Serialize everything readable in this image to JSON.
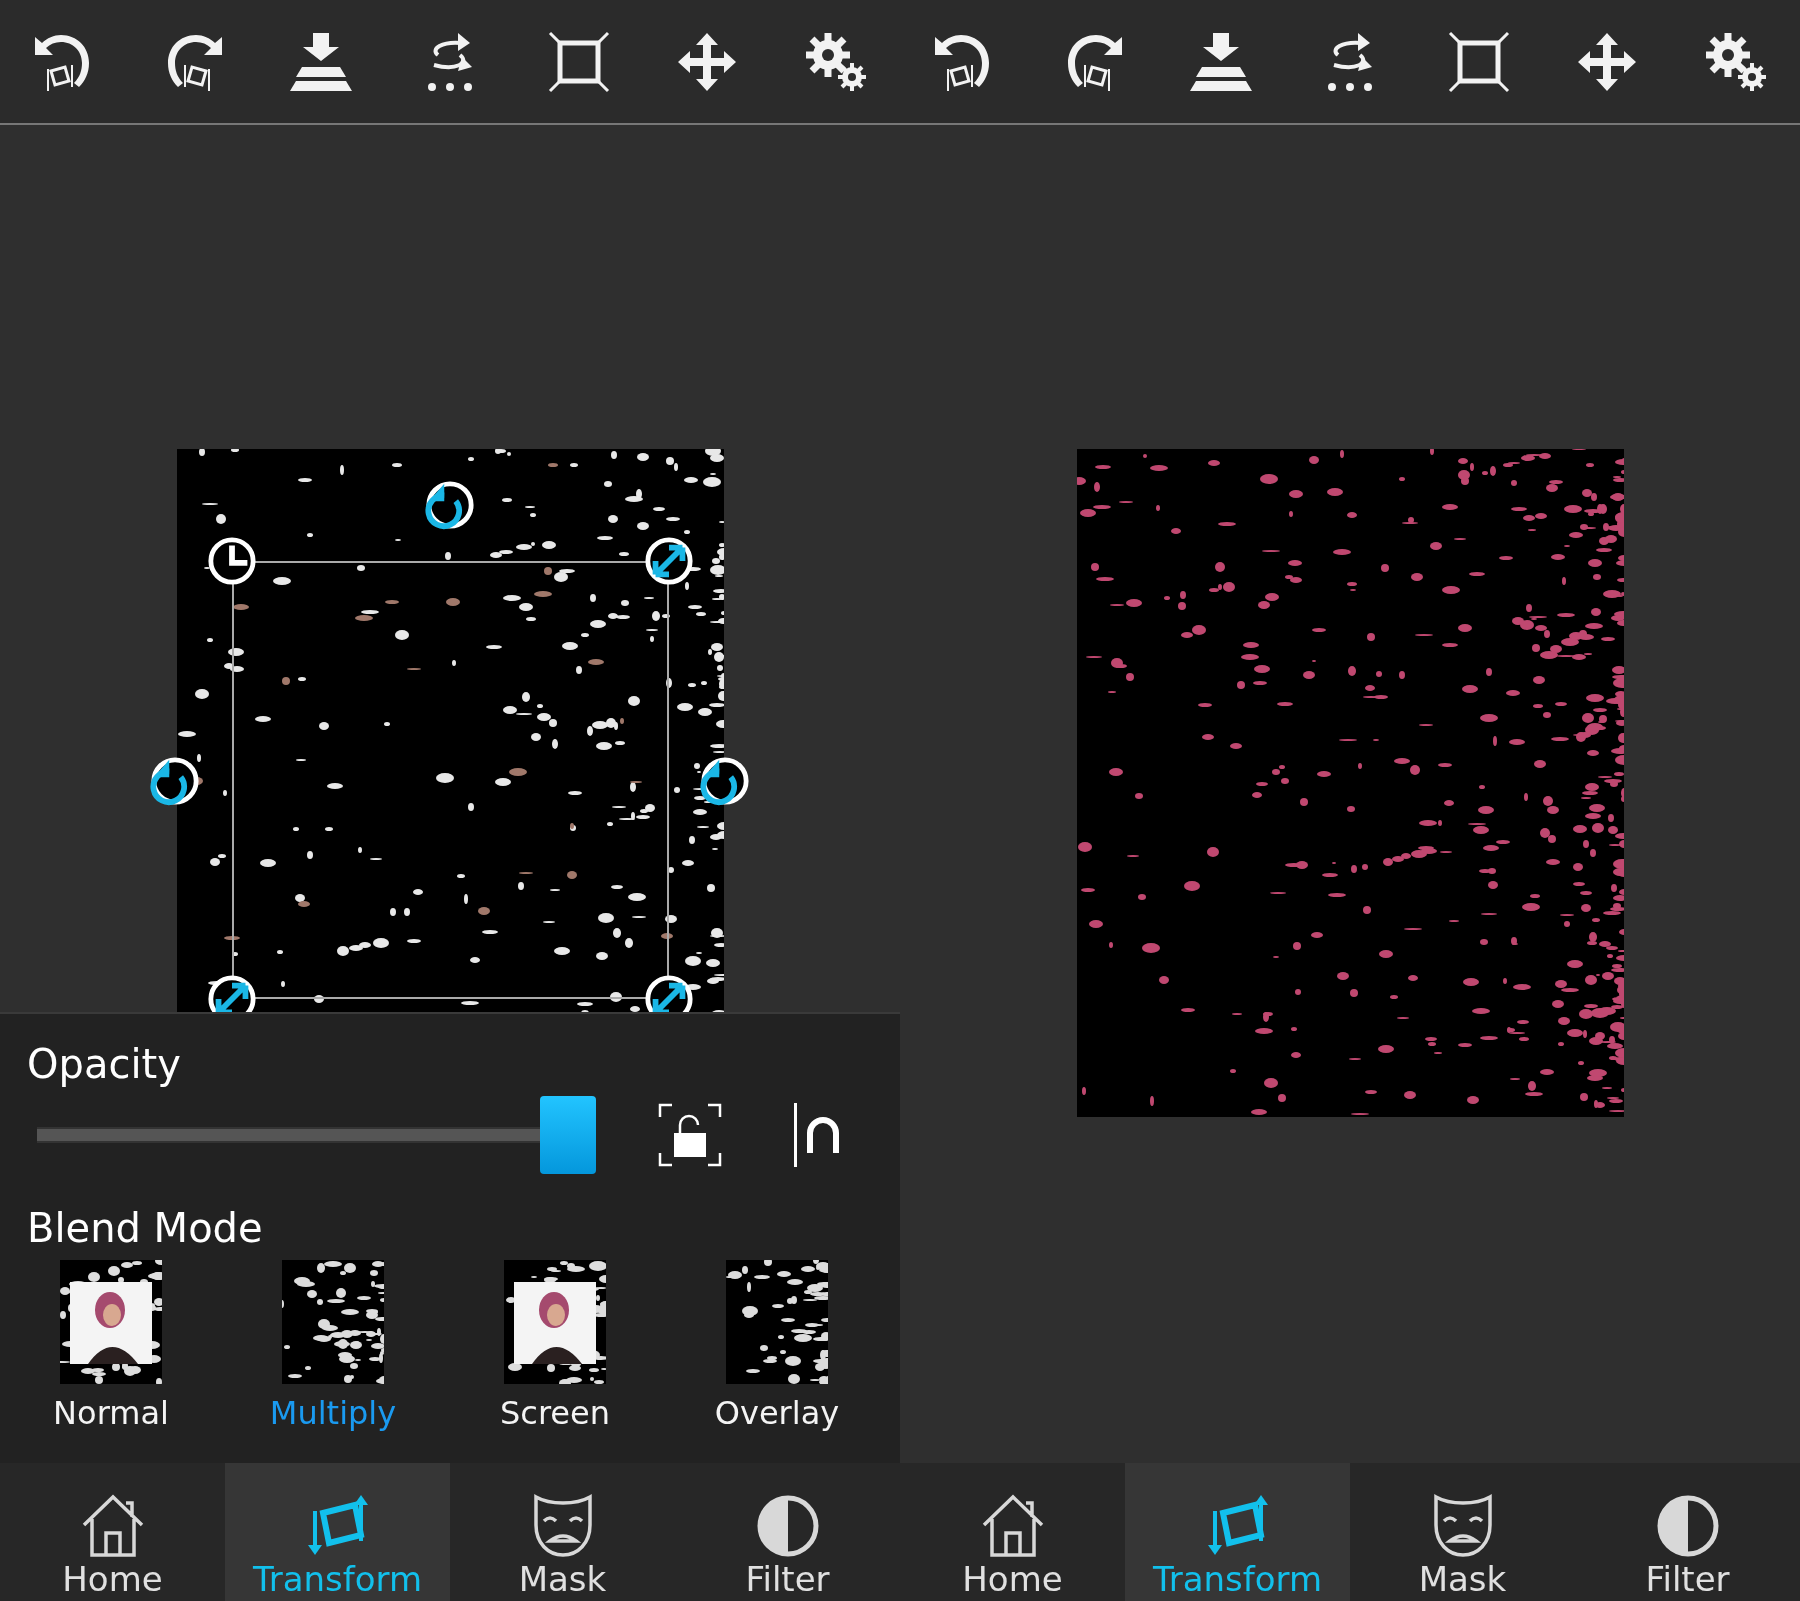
{
  "screens": [
    {
      "kind": "editor",
      "panel": {
        "opacity_label": "Opacity",
        "opacity_slider": {
          "level": 1
        },
        "blend_label": "Blend Mode",
        "blend_modes": [
          {
            "label": "Normal",
            "selected": false,
            "kind": "portrait"
          },
          {
            "label": "Multiply",
            "selected": true,
            "kind": "dark"
          },
          {
            "label": "Screen",
            "selected": false,
            "kind": "portrait"
          },
          {
            "label": "Overlay",
            "selected": false,
            "kind": "dark"
          }
        ]
      },
      "nav": [
        {
          "label": "Home",
          "selected": false,
          "kind": "home"
        },
        {
          "label": "Transform",
          "selected": true,
          "kind": "transform"
        },
        {
          "label": "Mask",
          "selected": false,
          "kind": "mask"
        },
        {
          "label": "Filter",
          "selected": false,
          "kind": "filter"
        }
      ]
    },
    {
      "kind": "preview",
      "nav": [
        {
          "label": "Home",
          "selected": false,
          "kind": "home"
        },
        {
          "label": "Transform",
          "selected": true,
          "kind": "transform"
        },
        {
          "label": "Mask",
          "selected": false,
          "kind": "mask"
        },
        {
          "label": "Filter",
          "selected": false,
          "kind": "filter"
        }
      ]
    }
  ]
}
